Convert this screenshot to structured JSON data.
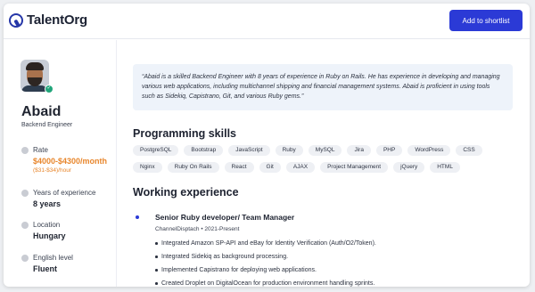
{
  "header": {
    "brand": "TalentOrg",
    "shortlist_label": "Add to shortlist"
  },
  "profile": {
    "name": "Abaid",
    "role": "Backend Engineer",
    "rate_label": "Rate",
    "rate_monthly": "$4000-$4300/month",
    "rate_hourly": "($31-$34)/hour",
    "experience_label": "Years of experience",
    "experience_value": "8 years",
    "location_label": "Location",
    "location_value": "Hungary",
    "english_label": "English level",
    "english_value": "Fluent"
  },
  "about": "“Abaid is a skilled Backend Engineer with 8 years of experience in Ruby on Rails. He has experience in developing and managing various web applications, including multichannel shipping and financial management systems. Abaid is proficient in using tools such as Sidekiq, Capistrano, Git, and various Ruby gems.”",
  "skills": {
    "title": "Programming skills",
    "items": [
      "PostgreSQL",
      "Bootstrap",
      "JavaScript",
      "Ruby",
      "MySQL",
      "Jira",
      "PHP",
      "WordPress",
      "CSS",
      "Nginx",
      "Ruby On Rails",
      "React",
      "Git",
      "AJAX",
      "Project Management",
      "jQuery",
      "HTML"
    ]
  },
  "experience": {
    "title": "Working experience",
    "jobs": [
      {
        "title": "Senior Ruby developer/ Team Manager",
        "company": "ChannelDisptach",
        "separator": "•",
        "period": "2021-Present",
        "bullets": [
          "Integrated Amazon SP-API and eBay for Identity Verification (Auth/O2/Token).",
          "Integrated Sidekiq as background processing.",
          "Implemented Capistrano for deploying web applications.",
          "Created Droplet on DigitalOcean for production environment handling sprints."
        ]
      }
    ]
  },
  "colors": {
    "accent": "#2b3ad6",
    "rate": "#e8862c",
    "about_bg": "#eef3fa",
    "verified": "#21a57a"
  },
  "icons": {
    "rate": "tag-icon",
    "experience": "award-icon",
    "location": "location-pin-icon",
    "english": "globe-icon"
  }
}
